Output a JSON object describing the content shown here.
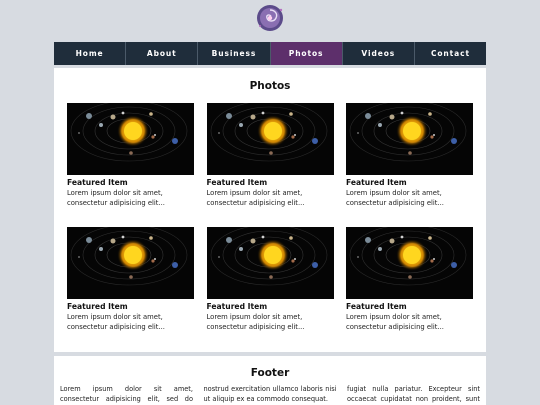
{
  "nav": {
    "items": [
      {
        "label": "Home",
        "active": false
      },
      {
        "label": "About",
        "active": false
      },
      {
        "label": "Business",
        "active": false
      },
      {
        "label": "Photos",
        "active": true
      },
      {
        "label": "Videos",
        "active": false
      },
      {
        "label": "Contact",
        "active": false
      }
    ]
  },
  "main": {
    "title": "Photos",
    "cards": [
      {
        "title": "Featured Item",
        "text_line1": "Lorem ipsum dolor sit amet,",
        "text_line2": "consectetur adipisicing elit..."
      },
      {
        "title": "Featured Item",
        "text_line1": "Lorem ipsum dolor sit amet,",
        "text_line2": "consectetur adipisicing elit..."
      },
      {
        "title": "Featured Item",
        "text_line1": "Lorem ipsum dolor sit amet,",
        "text_line2": "consectetur adipisicing elit..."
      },
      {
        "title": "Featured Item",
        "text_line1": "Lorem ipsum dolor sit amet,",
        "text_line2": "consectetur adipisicing elit..."
      },
      {
        "title": "Featured Item",
        "text_line1": "Lorem ipsum dolor sit amet,",
        "text_line2": "consectetur adipisicing elit..."
      },
      {
        "title": "Featured Item",
        "text_line1": "Lorem ipsum dolor sit amet,",
        "text_line2": "consectetur adipisicing elit..."
      }
    ]
  },
  "footer": {
    "title": "Footer",
    "columns": [
      "Lorem ipsum dolor sit amet, consectetur adipisicing elit, sed do eiusmod tempor",
      "nostrud exercitation ullamco laboris nisi ut aliquip ex ea commodo consequat.",
      "fugiat nulla pariatur. Excepteur sint occaecat cupidatat non proident, sunt in"
    ]
  },
  "colors": {
    "page_background": "#d7dbe1",
    "nav_background": "#1f2d3b",
    "nav_active": "#5d2f6b"
  },
  "icons": {
    "logo": "galaxy-logo-icon",
    "photo": "solar-system-image"
  }
}
